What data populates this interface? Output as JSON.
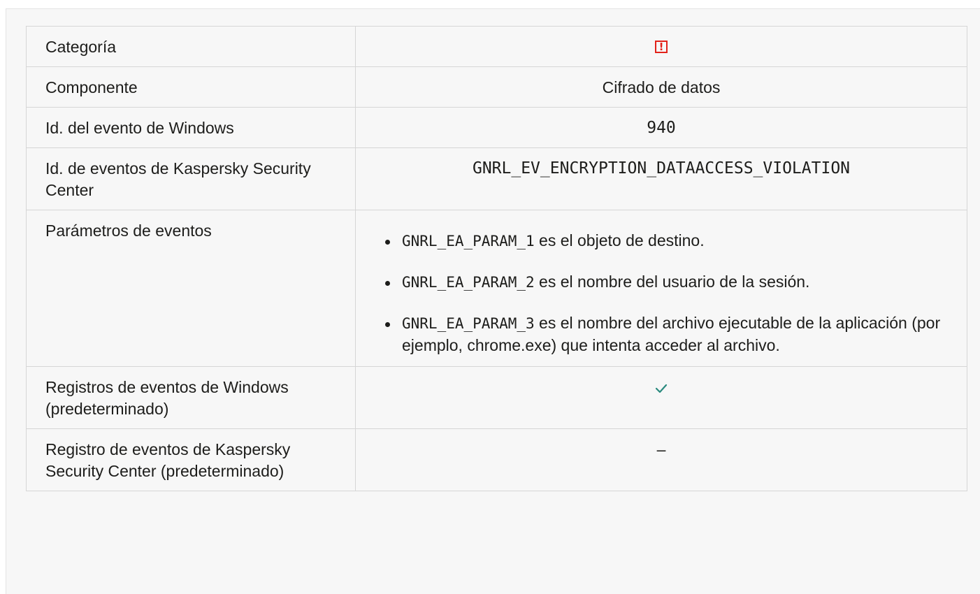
{
  "table": {
    "rows": [
      {
        "label": "Categoría",
        "icon": "red-exclamation-box-icon"
      },
      {
        "label": "Componente",
        "value": "Cifrado de datos"
      },
      {
        "label": "Id. del evento de Windows",
        "value": "940"
      },
      {
        "label": "Id. de eventos de Kaspersky Security Center",
        "value": "GNRL_EV_ENCRYPTION_DATAACCESS_VIOLATION"
      },
      {
        "label": "Parámetros de eventos",
        "params": [
          {
            "code": "GNRL_EA_PARAM_1",
            "text": " es el objeto de destino."
          },
          {
            "code": "GNRL_EA_PARAM_2",
            "text": " es el nombre del usuario de la sesión."
          },
          {
            "code": "GNRL_EA_PARAM_3",
            "text": " es el nombre del archivo ejecutable de la aplicación (por ejemplo, chrome.exe) que intenta acceder al archivo."
          }
        ]
      },
      {
        "label": "Registros de eventos de Windows (predeterminado)",
        "icon": "checkmark-icon"
      },
      {
        "label": "Registro de eventos de Kaspersky Security Center (predeterminado)",
        "value": "–"
      }
    ]
  },
  "colors": {
    "alert": "#e2231a",
    "check": "#2a8a7e",
    "border": "#d6d6d6",
    "background": "#f7f7f7"
  }
}
